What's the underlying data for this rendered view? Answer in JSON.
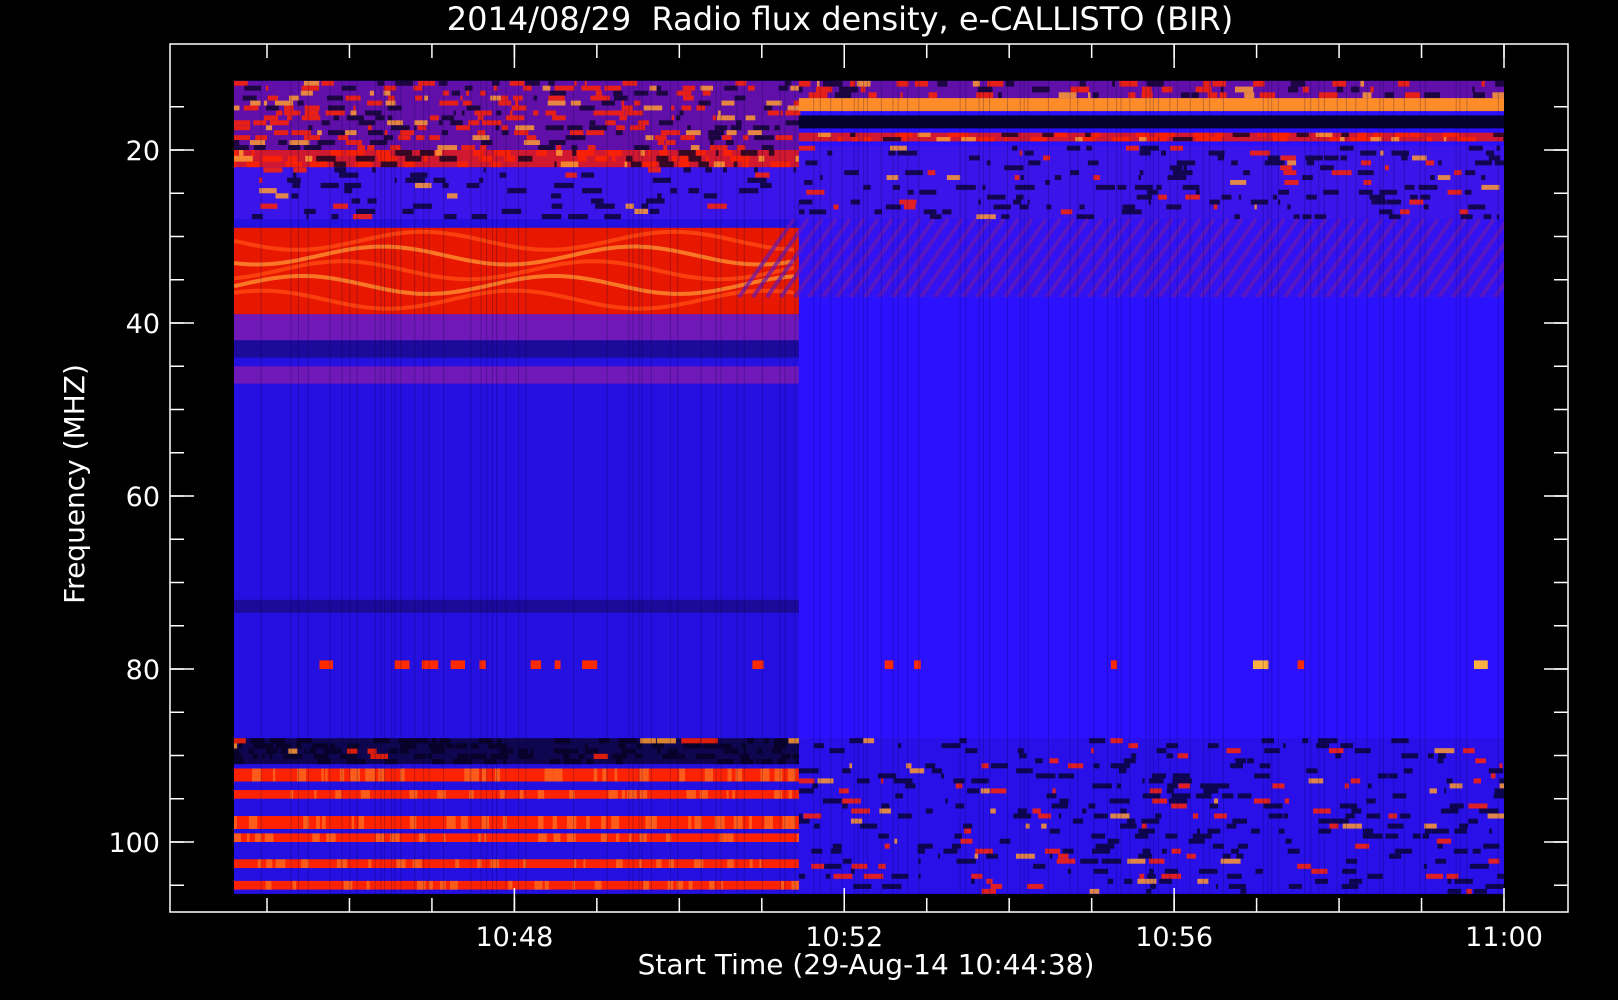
{
  "chart_data": {
    "type": "heatmap",
    "title": "2014/08/29  Radio flux density, e-CALLISTO (BIR)",
    "xlabel": "Start Time (29-Aug-14 10:44:38)",
    "ylabel": "Frequency (MHZ)",
    "x_axis": {
      "unit": "minutes after 10:44",
      "range": [
        10.74,
        11.0
      ],
      "tick_values": [
        10.8,
        10.8667,
        10.9333,
        11.0
      ],
      "tick_labels": [
        "10:48",
        "10:52",
        "10:56",
        "11:00"
      ],
      "minor_step_minutes": 1
    },
    "y_axis": {
      "unit": "MHz",
      "range": [
        10,
        108
      ],
      "inverted": true,
      "tick_values": [
        20,
        40,
        60,
        80,
        100
      ],
      "tick_labels": [
        "20",
        "40",
        "60",
        "80",
        "100"
      ],
      "minor_step": 5
    },
    "data_extent": {
      "time_start_min": 44.6,
      "time_end_min": 60.0,
      "freq_min": 12,
      "freq_max": 106
    },
    "segment_change_min": 51.45,
    "colormap": [
      "#000000",
      "#1a0080",
      "#2a10ff",
      "#8010a0",
      "#ff1a00",
      "#ff8c28",
      "#ffffc8"
    ],
    "segment_1": {
      "time_range_min": [
        44.6,
        51.45
      ],
      "bands": [
        {
          "freq": [
            12,
            20
          ],
          "level": "mixed-bursty"
        },
        {
          "freq": [
            20,
            22
          ],
          "level": "red-speckled"
        },
        {
          "freq": [
            22,
            28
          ],
          "level": "blue-speckled"
        },
        {
          "freq": [
            29,
            39
          ],
          "level": "red-wavy"
        },
        {
          "freq": [
            39,
            42
          ],
          "level": "purple"
        },
        {
          "freq": [
            42,
            44
          ],
          "level": "dark-blue"
        },
        {
          "freq": [
            45,
            47
          ],
          "level": "purple"
        },
        {
          "freq": [
            72,
            73.5
          ],
          "level": "dark-blue"
        },
        {
          "freq": [
            79,
            80
          ],
          "level": "red-dashes"
        },
        {
          "freq": [
            88,
            91
          ],
          "level": "dark-stripes"
        },
        {
          "freq": [
            91.5,
            93
          ],
          "level": "red"
        },
        {
          "freq": [
            94,
            95
          ],
          "level": "red"
        },
        {
          "freq": [
            97,
            98.5
          ],
          "level": "red"
        },
        {
          "freq": [
            99,
            100
          ],
          "level": "red"
        },
        {
          "freq": [
            102,
            103
          ],
          "level": "red"
        },
        {
          "freq": [
            104.5,
            105.5
          ],
          "level": "red"
        }
      ]
    },
    "segment_2": {
      "time_range_min": [
        51.45,
        60.0
      ],
      "bands": [
        {
          "freq": [
            12,
            14
          ],
          "level": "mixed-bursty"
        },
        {
          "freq": [
            14,
            15.5
          ],
          "level": "orange"
        },
        {
          "freq": [
            16,
            17.5
          ],
          "level": "dark"
        },
        {
          "freq": [
            18,
            19
          ],
          "level": "red-speckled"
        },
        {
          "freq": [
            19.5,
            28
          ],
          "level": "blue-speckled"
        },
        {
          "freq": [
            28,
            37
          ],
          "level": "diagonal-striations"
        },
        {
          "freq": [
            37,
            88
          ],
          "level": "blue"
        },
        {
          "freq": [
            79,
            80
          ],
          "level": "red-dashes"
        },
        {
          "freq": [
            88,
            106
          ],
          "level": "blue-dark-speckled"
        }
      ]
    }
  }
}
